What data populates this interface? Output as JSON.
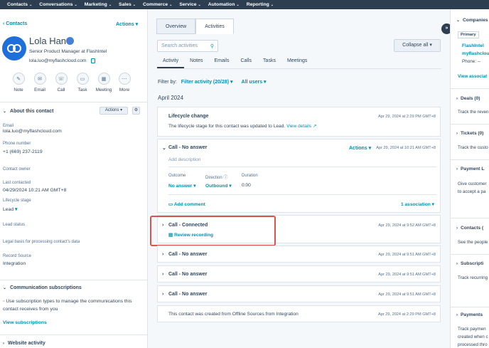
{
  "topnav": [
    "Contacts",
    "Conversations",
    "Marketing",
    "Sales",
    "Commerce",
    "Service",
    "Automation",
    "Reporting"
  ],
  "left": {
    "breadcrumb": "Contacts",
    "actions": "Actions",
    "name": "Lola Han",
    "job": "Senior Product Manager at FlashIntel",
    "email": "lola.luo@myflashcloud.com",
    "quick_actions": [
      {
        "label": "Note",
        "icon": "note-icon"
      },
      {
        "label": "Email",
        "icon": "email-icon"
      },
      {
        "label": "Call",
        "icon": "call-icon"
      },
      {
        "label": "Task",
        "icon": "task-icon"
      },
      {
        "label": "Meeting",
        "icon": "meeting-icon"
      },
      {
        "label": "More",
        "icon": "more-icon"
      }
    ],
    "about_title": "About this contact",
    "about_actions": "Actions",
    "fields": {
      "email_label": "Email",
      "email_value": "lola.luo@myflashcloud.com",
      "phone_label": "Phone number",
      "phone_value": "+1 (669) 237-2119",
      "owner_label": "Contact owner",
      "last_contacted_label": "Last contacted",
      "last_contacted_value": "04/29/2024 10:21 AM GMT+8",
      "lifecycle_label": "Lifecycle stage",
      "lifecycle_value": "Lead",
      "lead_status_label": "Lead status",
      "legal_label": "Legal basis for processing contact's data",
      "source_label": "Record Source",
      "source_value": "Integration"
    },
    "comm_title": "Communication subscriptions",
    "comm_text_1": "Use subscription types to manage the communications this",
    "comm_text_2": "contact receives from you",
    "comm_link": "View subscriptions",
    "website_title": "Website activity"
  },
  "center": {
    "tabs": [
      "Overview",
      "Activities"
    ],
    "search_placeholder": "Search activities",
    "collapse": "Collapse all",
    "subtabs": [
      "Activity",
      "Notes",
      "Emails",
      "Calls",
      "Tasks",
      "Meetings"
    ],
    "filter_by": "Filter by:",
    "filter_activity": "Filter activity (20/28)",
    "filter_users": "All users",
    "month": "April 2024",
    "lifecycle_card": {
      "title": "Lifecycle change",
      "date": "Apr 29, 2024 at 2:29 PM GMT+8",
      "body": "The lifecycle stage for this contact was updated to Lead.",
      "link": "View details"
    },
    "call_card": {
      "title": "Call - No answer",
      "actions": "Actions",
      "date": "Apr 29, 2024 at 10:21 AM GMT+8",
      "add_desc": "Add description",
      "outcome_label": "Outcome",
      "outcome_value": "No answer",
      "direction_label": "Direction",
      "direction_value": "Outbound",
      "duration_label": "Duration",
      "duration_value": "0:00",
      "add_comment": "Add comment",
      "association": "1 association"
    },
    "connected_card": {
      "title": "Call - Connected",
      "date": "Apr 29, 2024 at 9:52 AM GMT+8",
      "link": "Review recording"
    },
    "simple_calls": [
      {
        "title": "Call - No answer",
        "date": "Apr 29, 2024 at 9:51 AM GMT+8"
      },
      {
        "title": "Call - No answer",
        "date": "Apr 29, 2024 at 9:51 AM GMT+8"
      },
      {
        "title": "Call - No answer",
        "date": "Apr 29, 2024 at 9:51 AM GMT+8"
      }
    ],
    "created_card": {
      "body": "This contact was created from Offline Sources from Integration",
      "date": "Apr 29, 2024 at 2:29 PM GMT+8"
    }
  },
  "right": {
    "companies": "Companies",
    "primary": "Primary",
    "company_name": "FlashIntel",
    "company_domain": "myflashclou",
    "company_phone": "Phone: --",
    "view_assoc": "View associat",
    "deals": "Deals (0)",
    "deals_text": "Track the reven",
    "tickets": "Tickets (0)",
    "tickets_text": "Track the custo",
    "payment_links": "Payment L",
    "payment_links_text1": "Give customer",
    "payment_links_text2": "to accept a pa",
    "contacts": "Contacts (",
    "contacts_text": "See the people",
    "subscriptions": "Subscripti",
    "subscriptions_text": "Track recurring",
    "payments": "Payments",
    "payments_text1": "Track paymen",
    "payments_text2": "created when c",
    "payments_text3": "processed thro"
  },
  "colors": {
    "nav": "#2d3e50",
    "link": "#0091ae",
    "highlight": "#d9534f",
    "avatar": "#1e6fd9"
  }
}
